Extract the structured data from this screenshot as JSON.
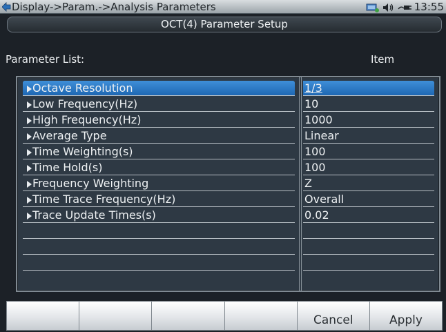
{
  "status_bar": {
    "path": "Display->Param.->Analysis Parameters",
    "time": "13:55",
    "icons": [
      "back-arrow-icon",
      "usb-icon",
      "speaker-icon",
      "power-plug-icon"
    ]
  },
  "title": "OCT(4) Parameter Setup",
  "parameter_list_label": "Parameter  List:",
  "item_label": "Item",
  "parameters": [
    {
      "name": "Octave Resolution",
      "value": "1/3"
    },
    {
      "name": "Low Frequency(Hz)",
      "value": "10"
    },
    {
      "name": "High Frequency(Hz)",
      "value": "1000"
    },
    {
      "name": "Average Type",
      "value": "Linear"
    },
    {
      "name": "Time Weighting(s)",
      "value": "100"
    },
    {
      "name": "Time Hold(s)",
      "value": "100"
    },
    {
      "name": "Frequency Weighting",
      "value": "Z"
    },
    {
      "name": "Time Trace Frequency(Hz)",
      "value": "Overall"
    },
    {
      "name": "Trace Update Times(s)",
      "value": "0.02"
    }
  ],
  "selected_index": 0,
  "softkeys": [
    "",
    "",
    "",
    "",
    "Cancel",
    "Apply"
  ],
  "colors": {
    "panel_bg": "#2e3944",
    "selection": "#2f7cc8",
    "screen_bg": "#1c2127"
  }
}
